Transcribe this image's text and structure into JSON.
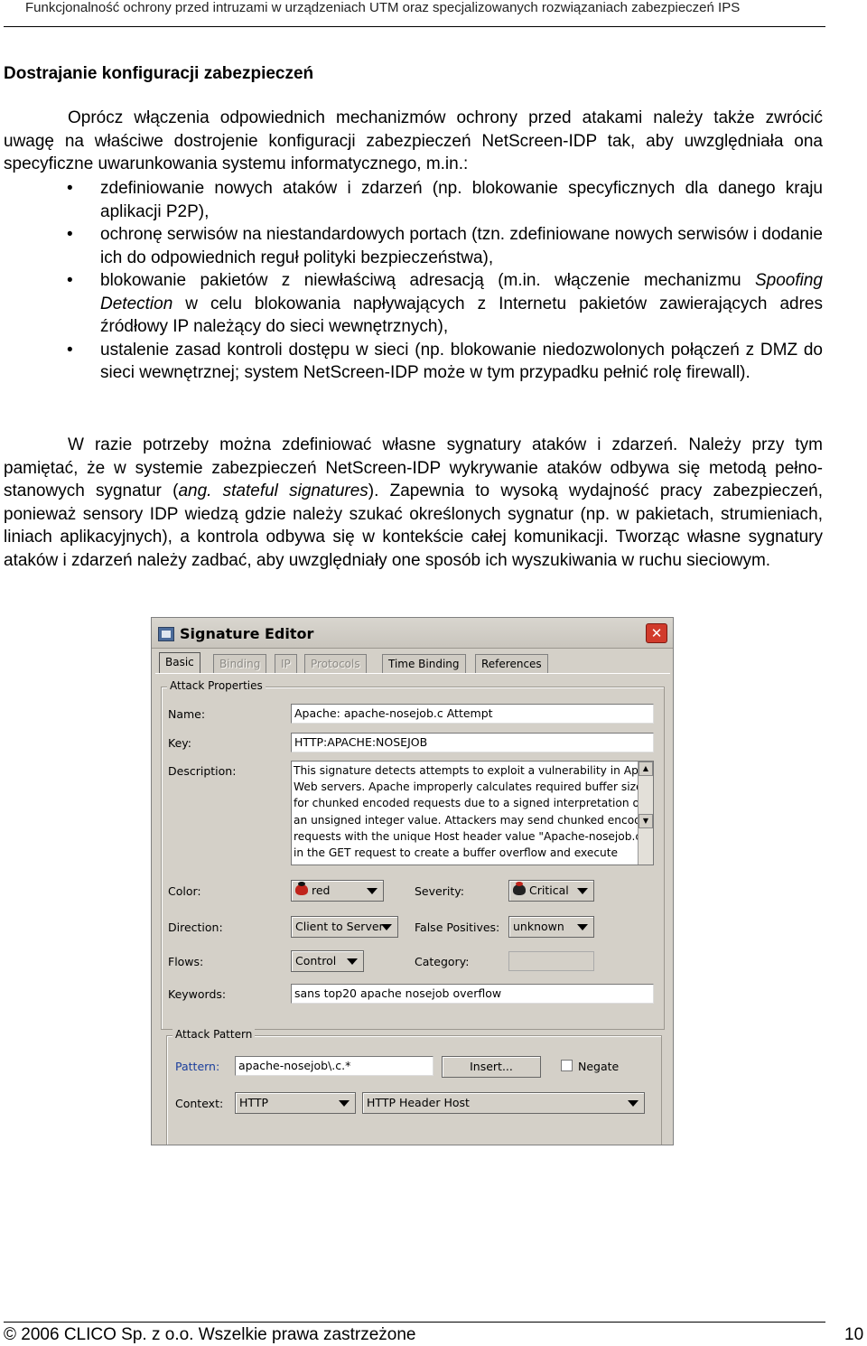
{
  "running_header": "Funkcjonalność ochrony przed intruzami w urządzeniach UTM oraz specjalizowanych rozwiązaniach zabezpieczeń IPS",
  "section_title": "Dostrajanie konfiguracji zabezpieczeń",
  "paragraph1": "Oprócz włączenia odpowiednich mechanizmów ochrony przed atakami należy także zwrócić uwagę na właściwe dostrojenie konfiguracji zabezpieczeń NetScreen-IDP tak, aby uwzględniała ona specyficzne uwarunkowania systemu informatycznego, m.in.:",
  "bullets": {
    "b1": "zdefiniowanie nowych ataków i zdarzeń (np. blokowanie specyficznych dla danego kraju aplikacji P2P),",
    "b2": "ochronę serwisów na niestandardowych portach (tzn. zdefiniowane nowych serwisów i dodanie ich do odpowiednich reguł polityki bezpieczeństwa),",
    "b3_before": "blokowanie pakietów z niewłaściwą adresacją (m.in. włączenie mechanizmu ",
    "b3_em": "Spoofing Detection",
    "b3_after": " w celu blokowania napływających z Internetu pakietów zawierających adres źródłowy IP należący do sieci wewnętrznych),",
    "b4": "ustalenie zasad kontroli dostępu w sieci (np. blokowanie niedozwolonych połączeń z DMZ do sieci wewnętrznej; system NetScreen-IDP może w tym przypadku pełnić rolę firewall)."
  },
  "paragraph2": {
    "before": "W razie potrzeby można zdefiniować własne sygnatury ataków i zdarzeń. Należy przy tym pamiętać, że w systemie zabezpieczeń NetScreen-IDP wykrywanie ataków odbywa się metodą pełno-stanowych sygnatur (",
    "em": "ang. stateful signatures",
    "after": "). Zapewnia to wysoką wydajność pracy zabezpieczeń, ponieważ sensory IDP wiedzą gdzie należy szukać określonych sygnatur (np. w pakietach, strumieniach, liniach aplikacyjnych), a kontrola odbywa się w kontekście całej komunikacji. Tworząc własne sygnatury ataków i zdarzeń należy zadbać, aby uwzględniały one sposób ich wyszukiwania w ruchu sieciowym."
  },
  "editor": {
    "title": "Signature Editor",
    "tabs": [
      "Basic",
      "Binding",
      "IP",
      "Protocols",
      "Time Binding",
      "References"
    ],
    "attack_properties": "Attack Properties",
    "name_label": "Name:",
    "name_value": "Apache: apache-nosejob.c Attempt",
    "key_label": "Key:",
    "key_value": "HTTP:APACHE:NOSEJOB",
    "description_label": "Description:",
    "description_lines": [
      "This signature detects attempts to exploit a vulnerability in Apache",
      "Web servers. Apache improperly calculates required buffer sizes",
      "for chunked encoded requests due to a signed interpretation of",
      "an unsigned integer value. Attackers may send chunked encoded",
      "requests with the unique Host header value \"Apache-nosejob.c\"",
      "in the GET request to create a buffer overflow and execute"
    ],
    "color_label": "Color:",
    "color_value": "red",
    "severity_label": "Severity:",
    "severity_value": "Critical",
    "direction_label": "Direction:",
    "direction_value": "Client to Server",
    "false_positives_label": "False Positives:",
    "false_positives_value": "unknown",
    "flows_label": "Flows:",
    "flows_value": "Control",
    "category_label": "Category:",
    "keywords_label": "Keywords:",
    "keywords_value": "sans top20 apache nosejob overflow",
    "attack_pattern": "Attack Pattern",
    "pattern_label": "Pattern:",
    "pattern_value": "apache-nosejob\\.c.*",
    "insert_label": "Insert...",
    "negate_label": "Negate",
    "context_label": "Context:",
    "context_value1": "HTTP",
    "context_value2": "HTTP Header Host"
  },
  "footer": "© 2006 CLICO Sp. z o.o. Wszelkie prawa zastrzeżone",
  "page_number": "10"
}
